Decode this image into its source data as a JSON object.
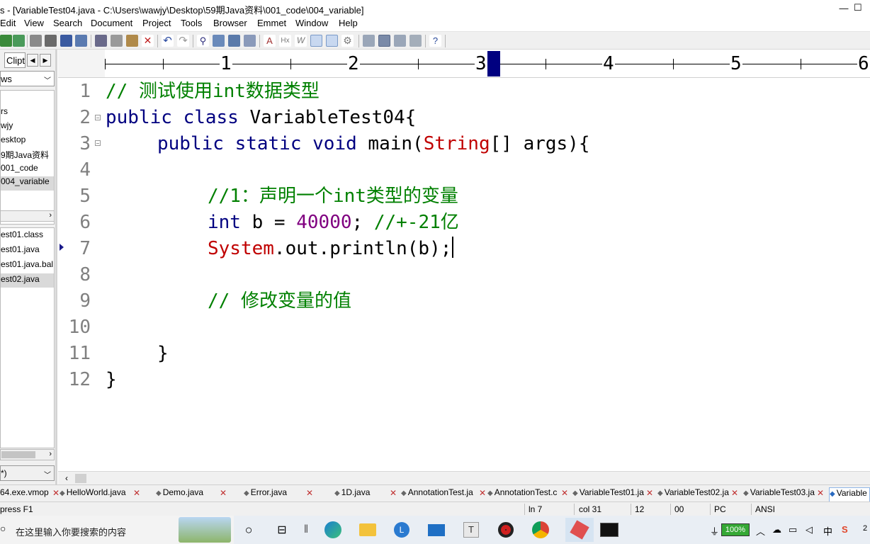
{
  "window": {
    "title": "s - [VariableTest04.java - C:\\Users\\wawjy\\Desktop\\59期Java资料\\001_code\\004_variable]"
  },
  "menu": [
    "Edit",
    "View",
    "Search",
    "Document",
    "Project",
    "Tools",
    "Browser",
    "Emmet",
    "Window",
    "Help"
  ],
  "left_panel": {
    "tab_label": "Clipt",
    "combo_value": "ws",
    "tree": [
      "rs",
      "wjy",
      "esktop",
      "9期Java资料",
      "001_code",
      "004_variable"
    ],
    "files": [
      "est01.class",
      "est01.java",
      "est01.java.bal",
      "est02.java"
    ],
    "bottom_combo": "*)"
  },
  "ruler": {
    "numbers": [
      "1",
      "2",
      "3",
      "4",
      "5",
      "6"
    ]
  },
  "editor": {
    "line_numbers": [
      "1",
      "2",
      "3",
      "4",
      "5",
      "6",
      "7",
      "8",
      "9",
      "10",
      "11",
      "12"
    ],
    "line1": "// 测试使用int数据类型",
    "line2_kw": "public class",
    "line2_rest": " VariableTest04{",
    "line3_kw": "public static void",
    "line3_a": " main(",
    "line3_type": "String",
    "line3_b": "[] args){",
    "line5": "//1：声明一个int类型的变量",
    "line6_kw": "int",
    "line6_a": " b = ",
    "line6_num": "40000",
    "line6_b": "; ",
    "line6_cm": "//+-21亿",
    "line7_type": "System",
    "line7_rest": ".out.println(b);",
    "line9": "// 修改变量的值",
    "line11": "}",
    "line12": "}"
  },
  "file_tabs": [
    "64.exe.vmop",
    "HelloWorld.java",
    "Demo.java",
    "Error.java",
    "1D.java",
    "AnnotationTest.ja",
    "AnnotationTest.c",
    "VariableTest01.ja",
    "VariableTest02.ja",
    "VariableTest03.ja",
    "Variable"
  ],
  "status": {
    "hint": "press F1",
    "line": "ln 7",
    "col": "col 31",
    "a": "12",
    "b": "00",
    "eol": "PC",
    "encoding": "ANSI"
  },
  "taskbar": {
    "search_placeholder": "在这里输入你要搜索的内容",
    "battery": "100%",
    "ime": "中",
    "clock_fragment": "2"
  },
  "colors": {
    "keyword": "#000080",
    "comment": "#008000",
    "type": "#c00000",
    "number": "#800080",
    "ruler_cursor": "#000080"
  }
}
